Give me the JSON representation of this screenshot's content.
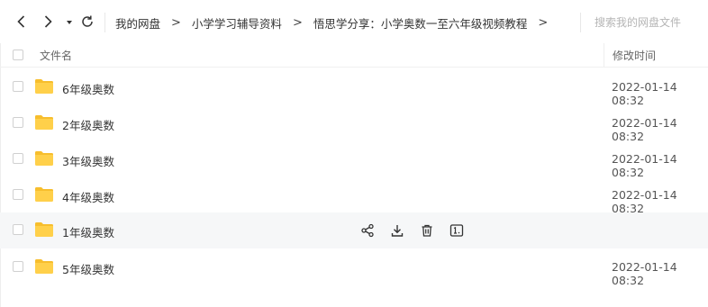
{
  "breadcrumb": {
    "items": [
      "我的网盘",
      "小学学习辅导资料",
      "悟思学分享：小学奥数一至六年级视频教程"
    ],
    "separator": ">"
  },
  "search": {
    "placeholder": "搜索我的网盘文件"
  },
  "columns": {
    "name": "文件名",
    "modified": "修改时间"
  },
  "files": [
    {
      "name": "6年级奥数",
      "modified": "2022-01-14 08:32",
      "type": "folder",
      "hovered": false
    },
    {
      "name": "2年级奥数",
      "modified": "2022-01-14 08:32",
      "type": "folder",
      "hovered": false
    },
    {
      "name": "3年级奥数",
      "modified": "2022-01-14 08:32",
      "type": "folder",
      "hovered": false
    },
    {
      "name": "4年级奥数",
      "modified": "2022-01-14 08:32",
      "type": "folder",
      "hovered": false
    },
    {
      "name": "1年级奥数",
      "modified": "",
      "type": "folder",
      "hovered": true
    },
    {
      "name": "5年级奥数",
      "modified": "2022-01-14 08:32",
      "type": "folder",
      "hovered": false
    }
  ],
  "row_actions": [
    "share-icon",
    "download-icon",
    "delete-icon",
    "rename-icon"
  ],
  "colors": {
    "folder": "#FFD04A",
    "folder_tab": "#F7BE2D",
    "hover_row": "#f6f7f8",
    "icon": "#333333"
  }
}
